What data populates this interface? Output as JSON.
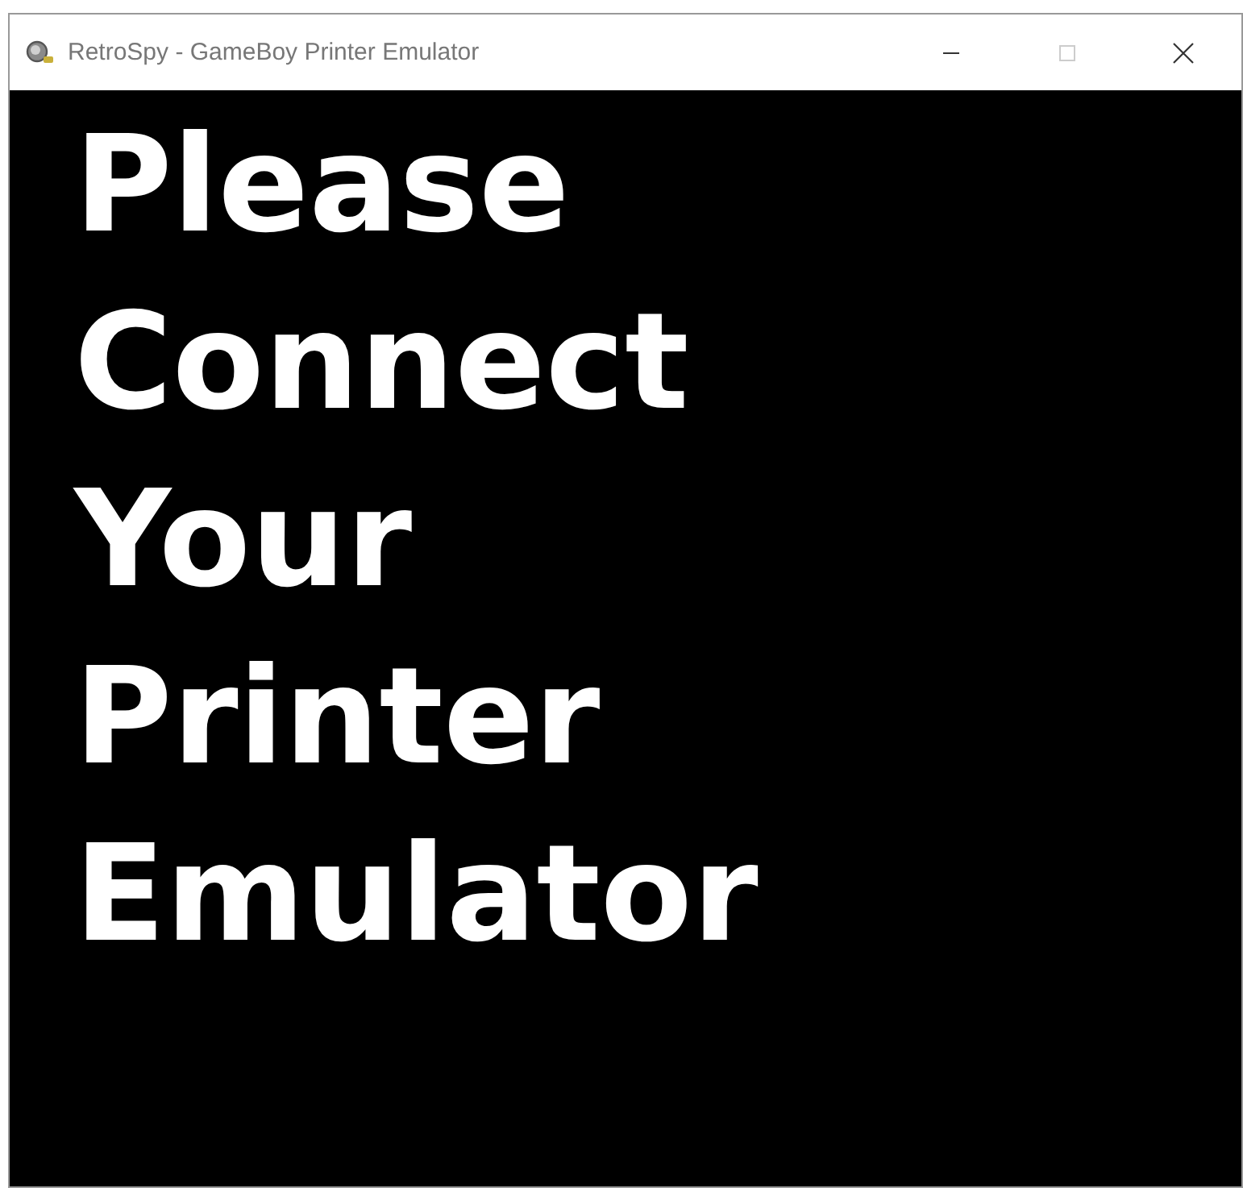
{
  "window": {
    "title": "RetroSpy - GameBoy Printer Emulator",
    "maximize_disabled": true
  },
  "message": {
    "lines": [
      "Please",
      "Connect",
      "Your",
      "Printer",
      "Emulator"
    ]
  }
}
